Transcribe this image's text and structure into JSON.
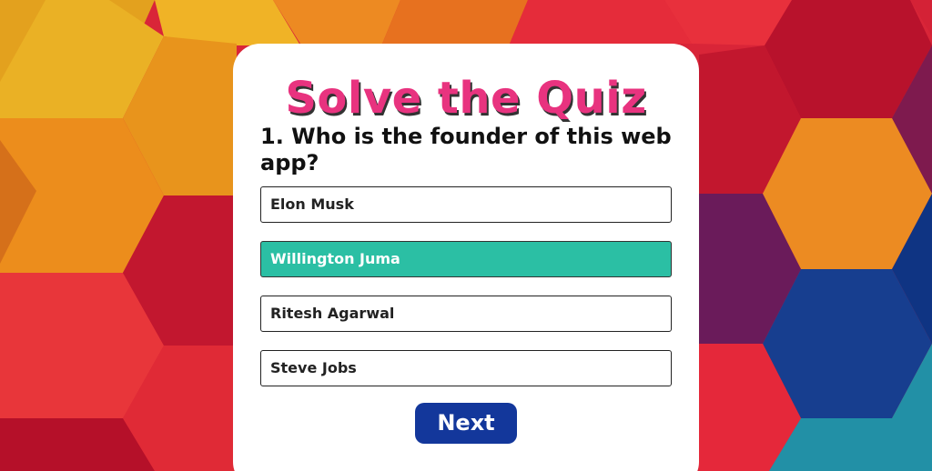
{
  "quiz": {
    "title": "Solve the Quiz",
    "question": "1. Who is the founder of this web app?",
    "options": [
      {
        "label": "Elon Musk",
        "selected": false
      },
      {
        "label": "Willington Juma",
        "selected": true
      },
      {
        "label": "Ritesh Agarwal",
        "selected": false
      },
      {
        "label": "Steve Jobs",
        "selected": false
      }
    ],
    "next_label": "Next"
  },
  "colors": {
    "title": "#e8337f",
    "selected_option": "#2bbfa4",
    "next_button": "#13379b",
    "card": "#ffffff"
  }
}
